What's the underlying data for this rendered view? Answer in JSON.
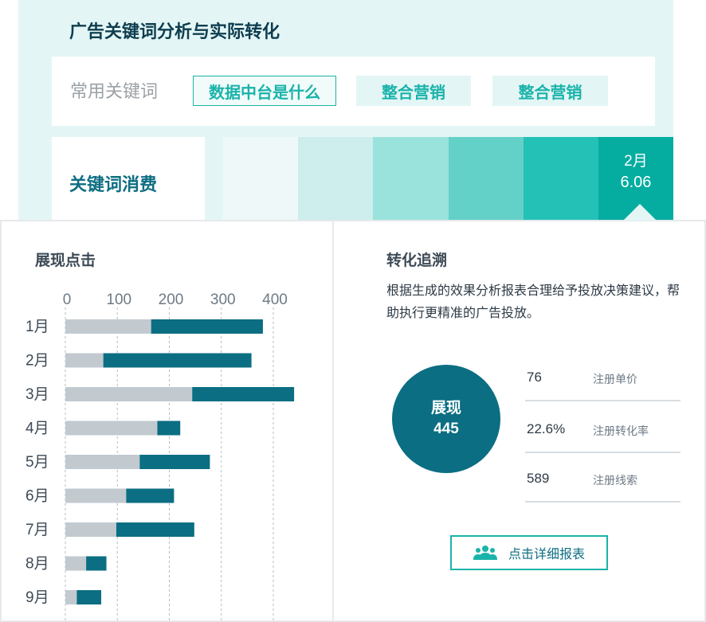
{
  "header": {
    "title": "广告关键词分析与实际转化"
  },
  "keywords": {
    "label": "常用关键词",
    "tags": [
      "数据中台是什么",
      "整合营销",
      "整合营销"
    ],
    "accent": "#1ab3aa"
  },
  "cost": {
    "label": "关键词消费",
    "active_month": "2月",
    "active_value": "6.06",
    "heat_colors": [
      "#eff8f9",
      "#cdeeed",
      "#9ae2dc",
      "#63d1c8",
      "#24c1b6",
      "#04ada0"
    ]
  },
  "impressions": {
    "title": "展现点击",
    "chart_data": {
      "type": "bar",
      "orientation": "horizontal",
      "stacked": true,
      "categories": [
        "1月",
        "2月",
        "3月",
        "4月",
        "5月",
        "6月",
        "7月",
        "8月",
        "9月"
      ],
      "ticks": [
        0,
        100,
        200,
        300,
        400
      ],
      "xlim": [
        0,
        400
      ],
      "grid": true,
      "series": [
        {
          "values": [
            165,
            73,
            244,
            177,
            143,
            117,
            98,
            40,
            22
          ],
          "color": "#c2cad0"
        },
        {
          "values": [
            215,
            285,
            196,
            44,
            135,
            92,
            150,
            39,
            47
          ],
          "color": "#0b6e82"
        }
      ]
    }
  },
  "conversion": {
    "title": "转化追溯",
    "description": "根据生成的效果分析报表合理给予投放决策建议，帮助执行更精准的广告投放。",
    "circle_label": "展现",
    "circle_value": "445",
    "metrics": [
      {
        "value": "76",
        "label": "注册单价"
      },
      {
        "value": "22.6%",
        "label": "注册转化率"
      },
      {
        "value": "589",
        "label": "注册线索"
      }
    ],
    "button_label": "点击详细报表",
    "primary_color": "#0b6e82"
  }
}
